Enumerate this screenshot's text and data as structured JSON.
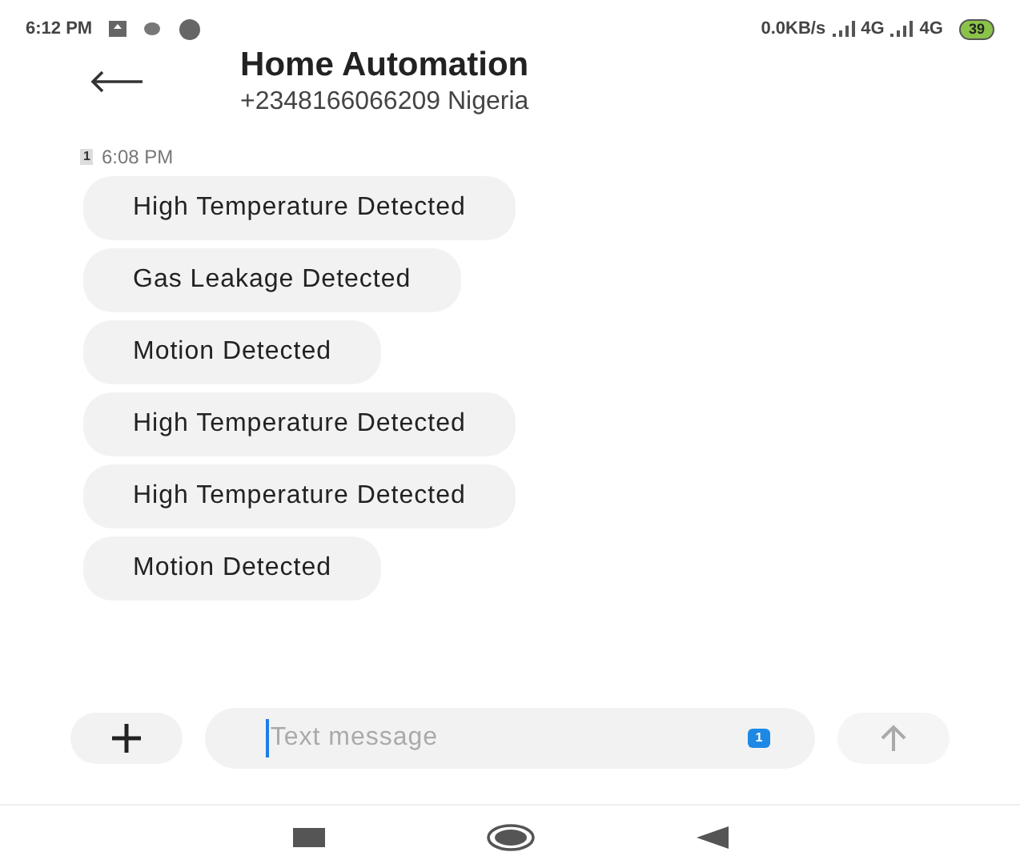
{
  "status_bar": {
    "time": "6:12 PM",
    "speed": "0.0KB/s",
    "networks": [
      "4G",
      "4G"
    ],
    "battery": "39"
  },
  "header": {
    "title": "Home Automation",
    "subtitle": "+2348166066209 Nigeria"
  },
  "timestamp": {
    "sim": "1",
    "time": "6:08 PM"
  },
  "messages": [
    {
      "text": "High Temperature Detected"
    },
    {
      "text": "Gas Leakage Detected"
    },
    {
      "text": "Motion Detected"
    },
    {
      "text": "High Temperature Detected"
    },
    {
      "text": "High Temperature Detected"
    },
    {
      "text": "Motion Detected"
    }
  ],
  "composer": {
    "placeholder": "Text message",
    "sim": "1"
  }
}
